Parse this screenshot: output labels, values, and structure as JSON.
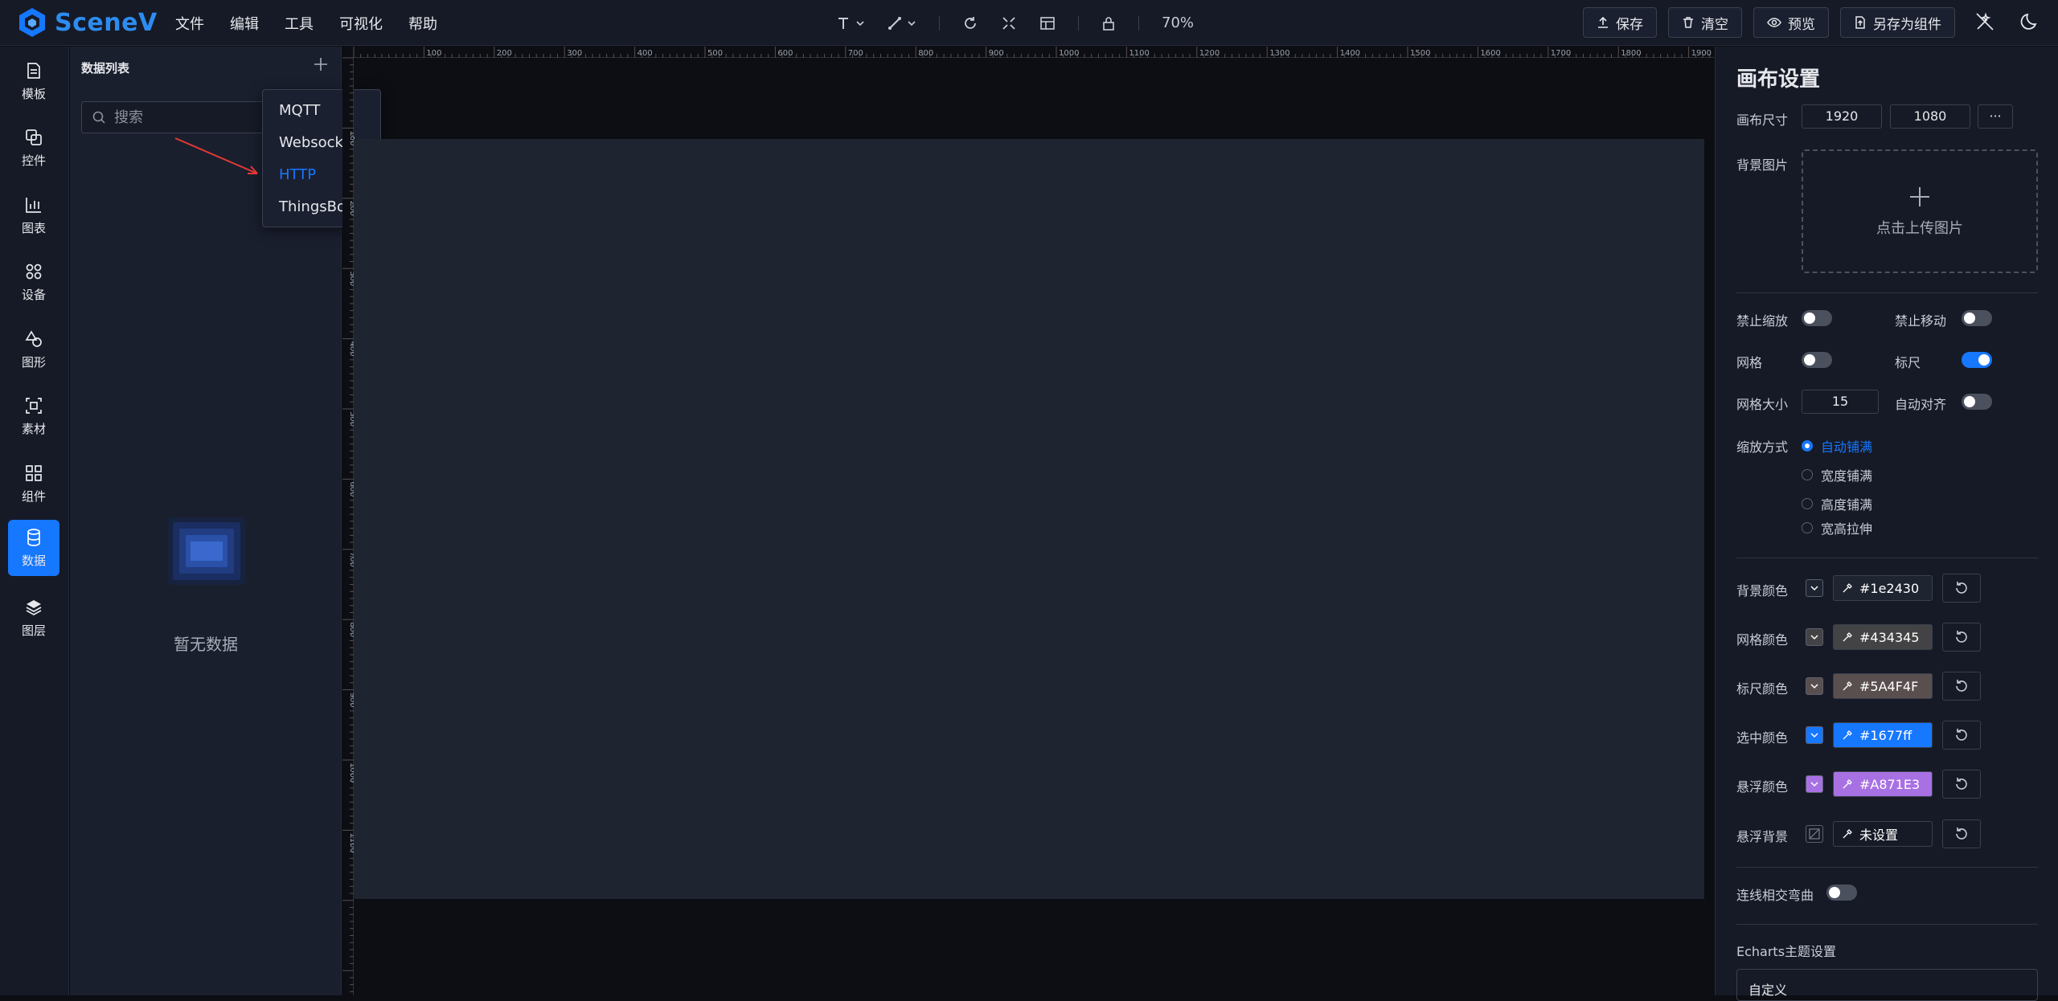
{
  "app": {
    "name": "SceneV"
  },
  "menu": [
    "文件",
    "编辑",
    "工具",
    "可视化",
    "帮助"
  ],
  "toolbar": {
    "zoom": "70%"
  },
  "actions": {
    "save": "保存",
    "clear": "清空",
    "preview": "预览",
    "save_as": "另存为组件"
  },
  "nav": [
    "模板",
    "控件",
    "图表",
    "设备",
    "图形",
    "素材",
    "组件",
    "数据",
    "图层"
  ],
  "data_panel": {
    "title": "数据列表",
    "search_placeholder": "搜索",
    "empty": "暂无数据",
    "dropdown": [
      "MQTT",
      "Websocket",
      "HTTP",
      "ThingsBoard"
    ],
    "dropdown_selected": "HTTP"
  },
  "ruler": {
    "top_ticks": [
      "100",
      "200",
      "300",
      "400",
      "500",
      "600",
      "700",
      "800",
      "900",
      "1000",
      "1100",
      "1200",
      "1300",
      "1400",
      "1500",
      "1600",
      "1700",
      "1800",
      "1900"
    ],
    "left_ticks": [
      "100",
      "200",
      "300",
      "400",
      "500",
      "600",
      "700",
      "800",
      "900",
      "1000",
      "1100"
    ]
  },
  "settings": {
    "title": "画布设置",
    "canvas_size_label": "画布尺寸",
    "width": "1920",
    "height": "1080",
    "more": "···",
    "bg_image_label": "背景图片",
    "upload_text": "点击上传图片",
    "disable_zoom": "禁止缩放",
    "disable_move": "禁止移动",
    "grid": "网格",
    "ruler": "标尺",
    "grid_size_label": "网格大小",
    "grid_size": "15",
    "auto_align": "自动对齐",
    "scale_mode_label": "缩放方式",
    "scale_modes": [
      "自动铺满",
      "宽度铺满",
      "高度铺满",
      "宽高拉伸"
    ],
    "scale_selected": "自动铺满",
    "toggles": {
      "disable_zoom": false,
      "disable_move": false,
      "grid": false,
      "ruler": true,
      "auto_align": false,
      "line_curve": false
    },
    "colors": [
      {
        "label": "背景颜色",
        "value": "#1e2430",
        "swatch": "#1e2430"
      },
      {
        "label": "网格颜色",
        "value": "#434345",
        "swatch": "#434345"
      },
      {
        "label": "标尺颜色",
        "value": "#5A4F4F",
        "swatch": "#5A4F4F"
      },
      {
        "label": "选中颜色",
        "value": "#1677ff",
        "swatch": "#1677ff"
      },
      {
        "label": "悬浮颜色",
        "value": "#A871E3",
        "swatch": "#A871E3"
      },
      {
        "label": "悬浮背景",
        "value": "未设置",
        "swatch": "#161a26"
      }
    ],
    "line_curve": "连线相交弯曲",
    "echarts_title": "Echarts主题设置",
    "echarts_value": "自定义"
  }
}
